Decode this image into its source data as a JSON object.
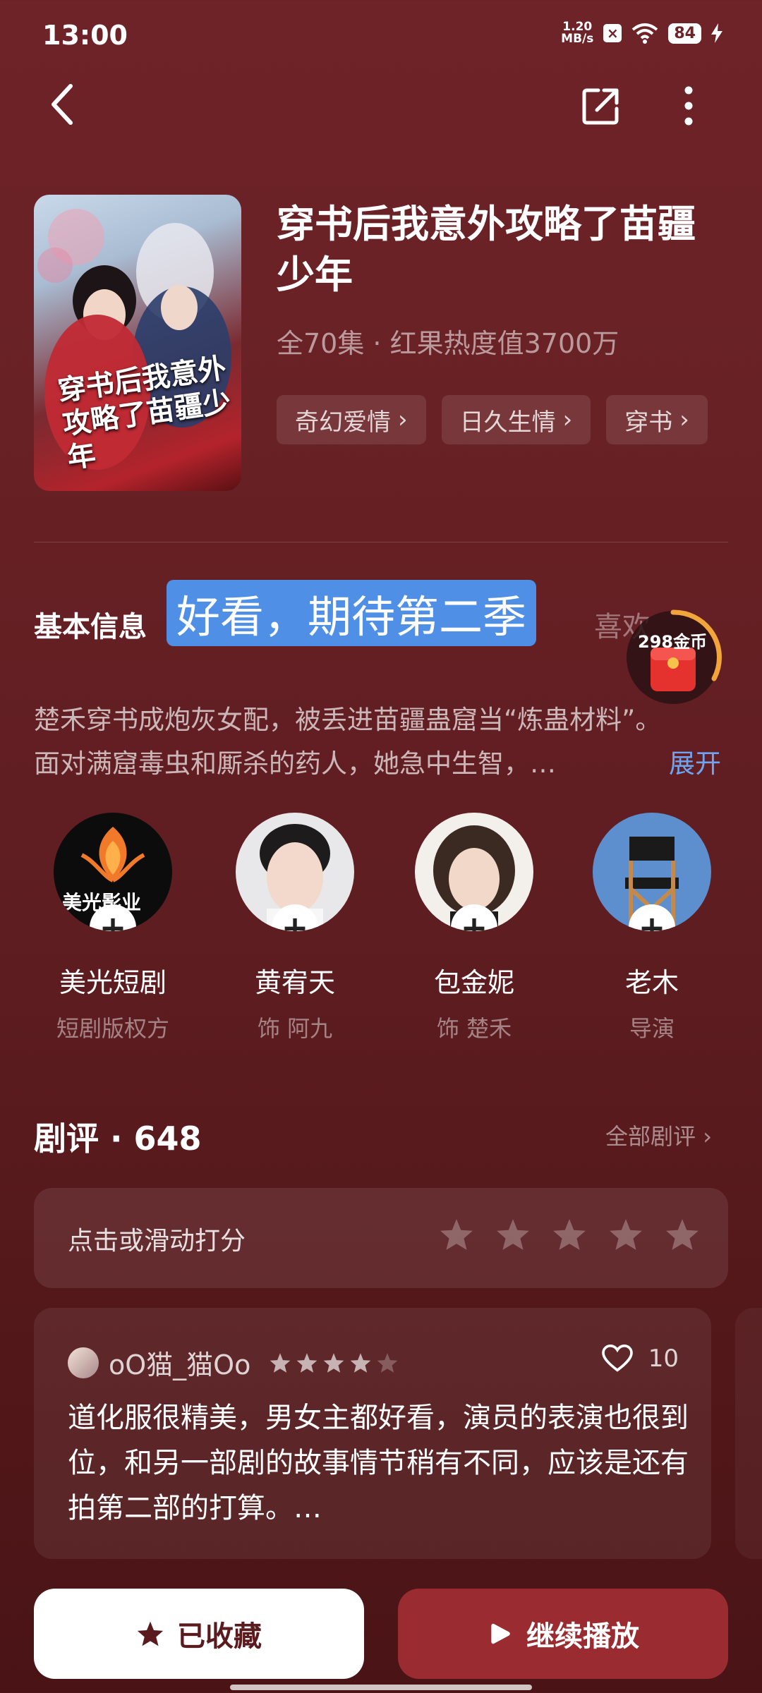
{
  "status_bar": {
    "time": "13:00",
    "net_speed_value": "1.20",
    "net_speed_unit": "MB/s",
    "battery": "84"
  },
  "drama": {
    "title": "穿书后我意外攻略了苗疆少年",
    "meta": "全70集 · 红果热度值3700万",
    "poster_title_text": "穿书后我意外攻略了苗疆少年",
    "tags": [
      "奇幻爱情",
      "日久生情",
      "穿书"
    ]
  },
  "basic_info": {
    "title": "基本信息",
    "likes_label": "喜欢",
    "danmaku": "好看，期待第二季",
    "coin_reward": "298金币",
    "synopsis_line1": "楚禾穿书成炮灰女配，被丢进苗疆蛊窟当“炼蛊材料”。",
    "synopsis_line2": "面对满窟毒虫和厮杀的药人，她急中生智，…",
    "expand_label": "展开"
  },
  "people": [
    {
      "name": "美光短剧",
      "role": "短剧版权方",
      "logo_text": "美光影业",
      "avatar_icon": "phoenix-logo"
    },
    {
      "name": "黄宥天",
      "role": "饰 阿九",
      "avatar_icon": "actor-photo"
    },
    {
      "name": "包金妮",
      "role": "饰 楚禾",
      "avatar_icon": "actress-photo"
    },
    {
      "name": "老木",
      "role": "导演",
      "avatar_icon": "director-chair"
    }
  ],
  "reviews": {
    "title": "剧评 · 648",
    "all_label": "全部剧评",
    "rate_prompt": "点击或滑动打分",
    "rate_stars_max": 5,
    "items": [
      {
        "user": "oO猫_猫Oo",
        "rating": 4,
        "likes": "10",
        "text": "道化服很精美，男女主都好看，演员的表演也很到位，和另一部剧的故事情节稍有不同，应该是还有拍第二部的打算。…"
      }
    ]
  },
  "actions": {
    "collect_label": "已收藏",
    "play_label": "继续播放"
  },
  "colors": {
    "background": "#6e2328",
    "play_button": "#9a2c31",
    "danmaku_bg": "#4f8fe6",
    "expand_link": "#6ea4f2",
    "coin_ring": "#f2a53a"
  }
}
